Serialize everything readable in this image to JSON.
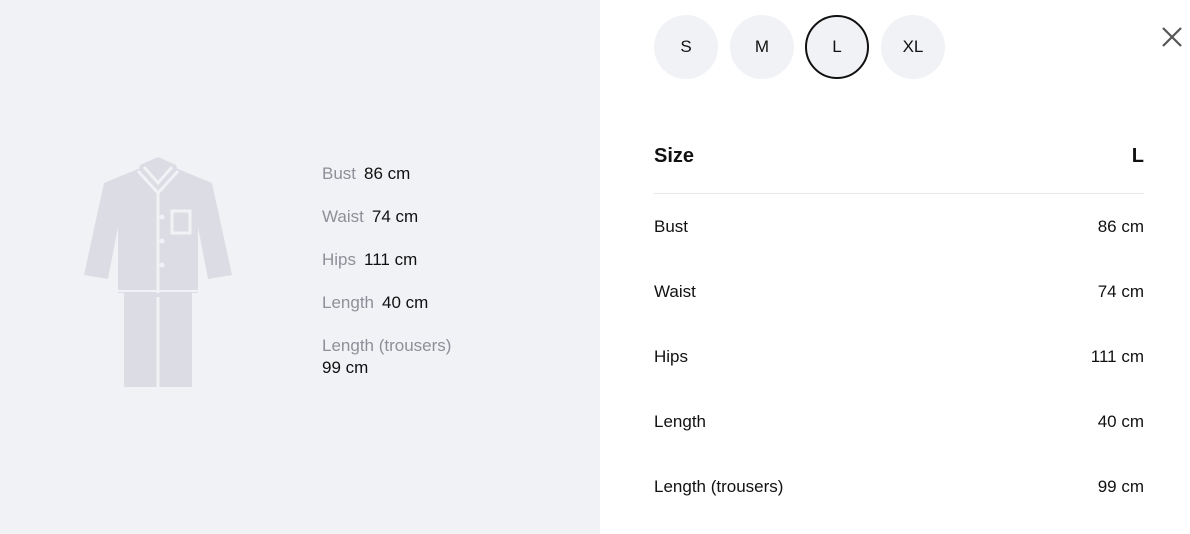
{
  "left": {
    "measurements": [
      {
        "label": "Bust",
        "value": "86 cm"
      },
      {
        "label": "Waist",
        "value": "74 cm"
      },
      {
        "label": "Hips",
        "value": "111 cm"
      },
      {
        "label": "Length",
        "value": "40 cm"
      },
      {
        "label": "Length (trousers)",
        "value": "99 cm"
      }
    ]
  },
  "sizes": [
    "S",
    "M",
    "L",
    "XL"
  ],
  "selected_size": "L",
  "table": {
    "header_label": "Size",
    "header_value": "L",
    "rows": [
      {
        "label": "Bust",
        "value": "86 cm"
      },
      {
        "label": "Waist",
        "value": "74 cm"
      },
      {
        "label": "Hips",
        "value": "111 cm"
      },
      {
        "label": "Length",
        "value": "40 cm"
      },
      {
        "label": "Length (trousers)",
        "value": "99 cm"
      }
    ]
  },
  "icons": {
    "close": "close-icon",
    "garment": "pajama-set-icon"
  },
  "colors": {
    "panel_bg": "#f1f2f5",
    "label_gray": "#8f8f99",
    "selected_border": "#111111"
  }
}
